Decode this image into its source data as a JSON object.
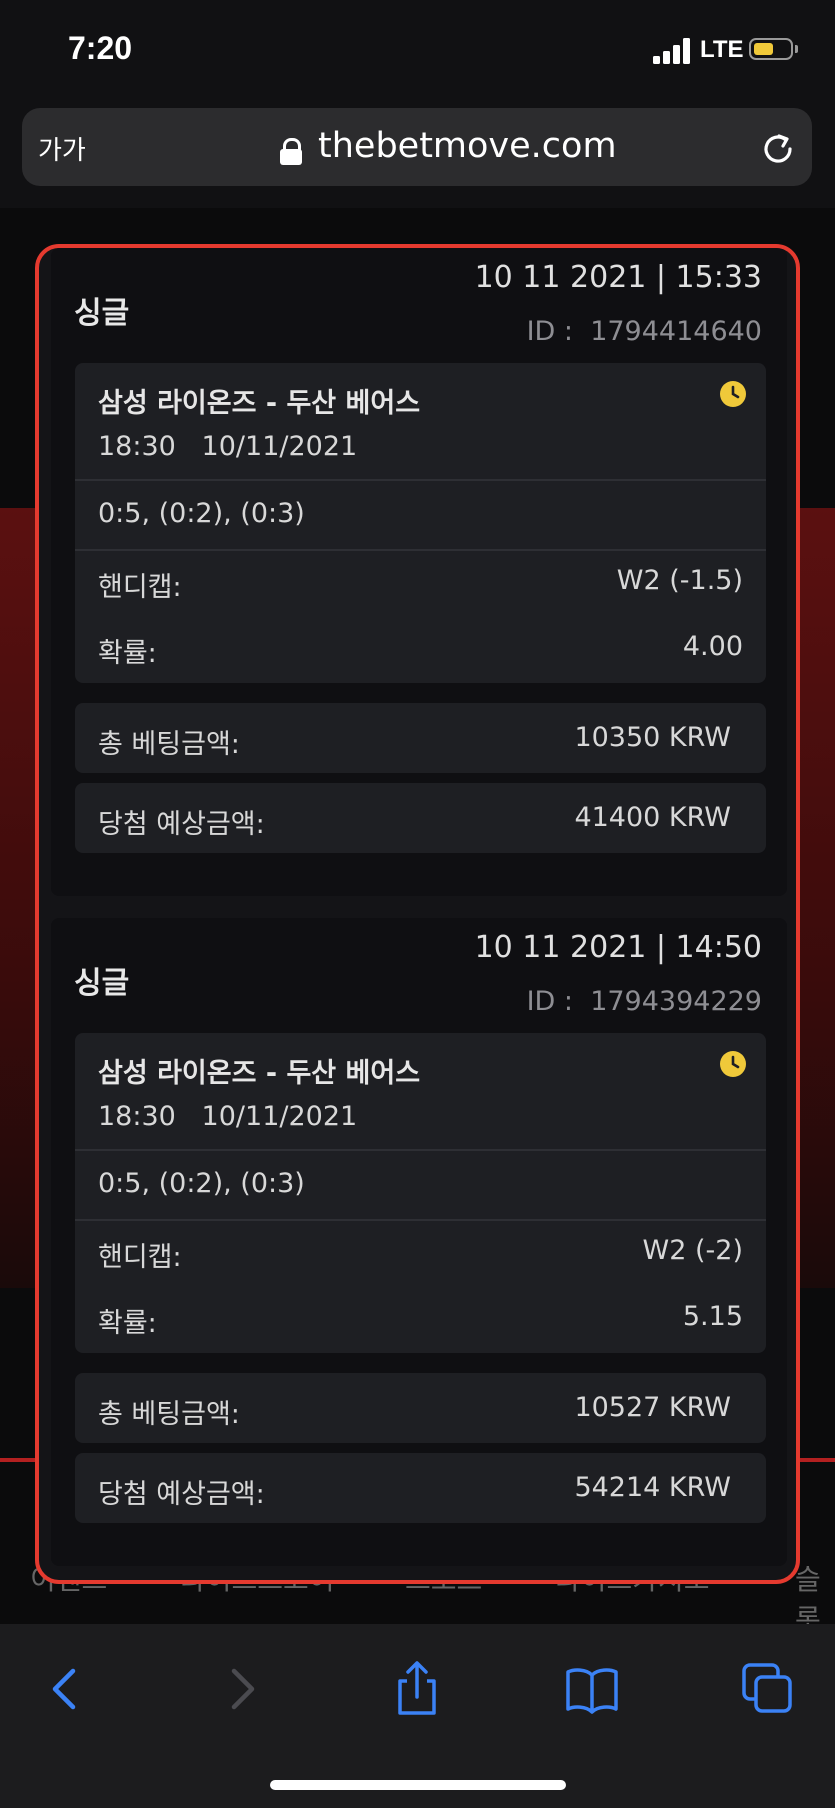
{
  "status_bar": {
    "time": "7:20",
    "network": "LTE"
  },
  "url_bar": {
    "text_size_label": "가가",
    "url": "thebetmove.com"
  },
  "site_nav": [
    "이벤트",
    "라이브스코어",
    "스포츠",
    "라이브카지노",
    "슬롯"
  ],
  "bets": [
    {
      "type": "싱글",
      "datetime": "10 11 2021 | 15:33",
      "id_label": "ID :",
      "id": "1794414640",
      "match": "삼성 라이온즈 - 두산 베어스",
      "kickoff": "18:30   10/11/2021",
      "score": "0:5, (0:2), (0:3)",
      "market_label": "핸디캡:",
      "market_value": "W2 (-1.5)",
      "odds_label": "확률:",
      "odds_value": "4.00",
      "stake_label": "총 베팅금액:",
      "stake_value": "10350 KRW",
      "payout_label": "당첨 예상금액:",
      "payout_value": "41400 KRW"
    },
    {
      "type": "싱글",
      "datetime": "10 11 2021 | 14:50",
      "id_label": "ID :",
      "id": "1794394229",
      "match": "삼성 라이온즈 - 두산 베어스",
      "kickoff": "18:30   10/11/2021",
      "score": "0:5, (0:2), (0:3)",
      "market_label": "핸디캡:",
      "market_value": "W2 (-2)",
      "odds_label": "확률:",
      "odds_value": "5.15",
      "stake_label": "총 베팅금액:",
      "stake_value": "10527 KRW",
      "payout_label": "당첨 예상금액:",
      "payout_value": "54214 KRW"
    }
  ],
  "colors": {
    "accent_border": "#e53a2f",
    "pending_clock": "#f0c93a",
    "toolbar_icon": "#3b82f6"
  },
  "icons": [
    "signal-icon",
    "battery-icon",
    "lock-icon",
    "reload-icon",
    "clock-icon",
    "back-icon",
    "forward-icon",
    "share-icon",
    "bookmarks-icon",
    "tabs-icon"
  ]
}
